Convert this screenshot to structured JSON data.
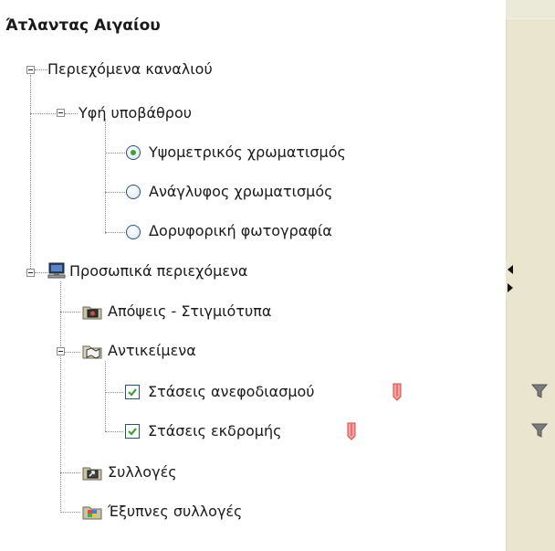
{
  "panel": {
    "title": "Άτλαντας Αιγαίου"
  },
  "tree": {
    "channel_contents": {
      "label": "Περιεχόμενα καναλιού",
      "background_texture": {
        "label": "Υφή υποβάθρου",
        "options": [
          {
            "label": "Υψομετρικός χρωματισμός",
            "selected": true
          },
          {
            "label": "Ανάγλυφος χρωματισμός",
            "selected": false
          },
          {
            "label": "Δορυφορική φωτογραφία",
            "selected": false
          }
        ]
      }
    },
    "personal_contents": {
      "label": "Προσωπικά περιεχόμενα",
      "views": {
        "label": "Απόψεις - Στιγμιότυπα"
      },
      "objects": {
        "label": "Αντικείμενα",
        "items": [
          {
            "label": "Στάσεις ανεφοδιασμού",
            "checked": true
          },
          {
            "label": "Στάσεις εκδρομής",
            "checked": true
          }
        ]
      },
      "collections": {
        "label": "Συλλογές"
      },
      "smart_collections": {
        "label": "Έξυπνες συλλογές"
      }
    }
  },
  "colors": {
    "accent_green": "#3aa33a",
    "marker_red": "#e05a5a",
    "sidebar_bg": "#e9e5cf"
  }
}
